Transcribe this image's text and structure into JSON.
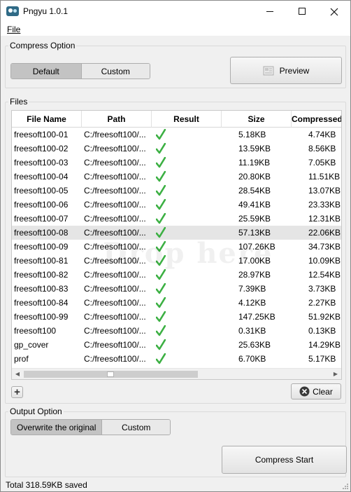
{
  "window": {
    "title": "Pngyu 1.0.1"
  },
  "menu": {
    "file": "File"
  },
  "compress_option": {
    "label": "Compress Option",
    "default_label": "Default",
    "custom_label": "Custom",
    "preview_label": "Preview"
  },
  "files": {
    "label": "Files",
    "columns": [
      "File Name",
      "Path",
      "Result",
      "Size",
      "Compressed"
    ],
    "rows": [
      {
        "name": "freesoft100-01",
        "path": "C:/freesoft100/...",
        "size": "5.18KB",
        "compressed": "4.74KB"
      },
      {
        "name": "freesoft100-02",
        "path": "C:/freesoft100/...",
        "size": "13.59KB",
        "compressed": "8.56KB"
      },
      {
        "name": "freesoft100-03",
        "path": "C:/freesoft100/...",
        "size": "11.19KB",
        "compressed": "7.05KB"
      },
      {
        "name": "freesoft100-04",
        "path": "C:/freesoft100/...",
        "size": "20.80KB",
        "compressed": "11.51KB"
      },
      {
        "name": "freesoft100-05",
        "path": "C:/freesoft100/...",
        "size": "28.54KB",
        "compressed": "13.07KB"
      },
      {
        "name": "freesoft100-06",
        "path": "C:/freesoft100/...",
        "size": "49.41KB",
        "compressed": "23.33KB"
      },
      {
        "name": "freesoft100-07",
        "path": "C:/freesoft100/...",
        "size": "25.59KB",
        "compressed": "12.31KB"
      },
      {
        "name": "freesoft100-08",
        "path": "C:/freesoft100/...",
        "size": "57.13KB",
        "compressed": "22.06KB"
      },
      {
        "name": "freesoft100-09",
        "path": "C:/freesoft100/...",
        "size": "107.26KB",
        "compressed": "34.73KB"
      },
      {
        "name": "freesoft100-81",
        "path": "C:/freesoft100/...",
        "size": "17.00KB",
        "compressed": "10.09KB"
      },
      {
        "name": "freesoft100-82",
        "path": "C:/freesoft100/...",
        "size": "28.97KB",
        "compressed": "12.54KB"
      },
      {
        "name": "freesoft100-83",
        "path": "C:/freesoft100/...",
        "size": "7.39KB",
        "compressed": "3.73KB"
      },
      {
        "name": "freesoft100-84",
        "path": "C:/freesoft100/...",
        "size": "4.12KB",
        "compressed": "2.27KB"
      },
      {
        "name": "freesoft100-99",
        "path": "C:/freesoft100/...",
        "size": "147.25KB",
        "compressed": "51.92KB"
      },
      {
        "name": "freesoft100",
        "path": "C:/freesoft100/...",
        "size": "0.31KB",
        "compressed": "0.13KB"
      },
      {
        "name": "gp_cover",
        "path": "C:/freesoft100/...",
        "size": "25.63KB",
        "compressed": "14.29KB"
      },
      {
        "name": "prof",
        "path": "C:/freesoft100/...",
        "size": "6.70KB",
        "compressed": "5.17KB"
      }
    ],
    "selected_row": "freesoft100-08",
    "watermark": "Drop here",
    "add_label": "+",
    "clear_label": "Clear"
  },
  "output_option": {
    "label": "Output Option",
    "overwrite_label": "Overwrite the original",
    "custom_label": "Custom",
    "compress_start_label": "Compress Start"
  },
  "status": {
    "text": "Total 318.59KB saved"
  },
  "colors": {
    "check": "#3cb043",
    "selected_row": "#e5e5e5",
    "clear_icon": "#3a3a3a"
  }
}
